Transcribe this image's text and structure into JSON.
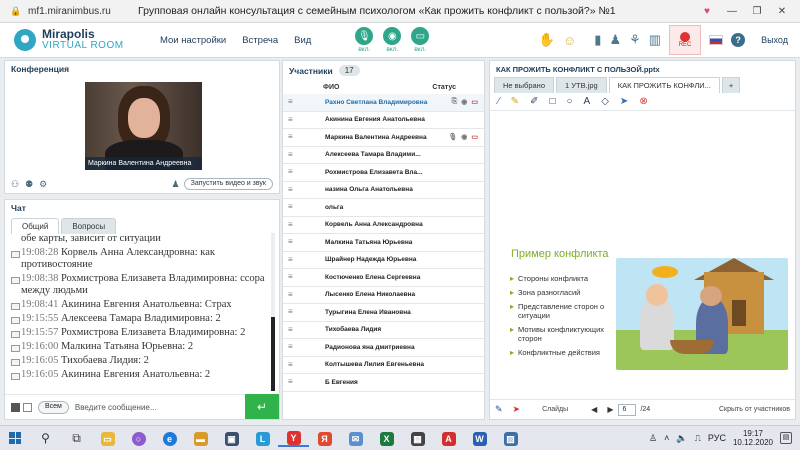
{
  "browser": {
    "domain": "mf1.miranimbus.ru",
    "title": "Групповая онлайн консультация с семейным психологом «Как прожить конфликт с пользой?» №1"
  },
  "header": {
    "logo_line1": "Mirapolis",
    "logo_line2": "VIRTUAL ROOM",
    "menu": [
      "Мои настройки",
      "Встреча",
      "Вид"
    ],
    "toggles": [
      {
        "icon": "microphone-icon",
        "label": "вкл."
      },
      {
        "icon": "camera-icon",
        "label": "вкл."
      },
      {
        "icon": "screen-share-icon",
        "label": "вкл."
      }
    ],
    "rec_label": "REC",
    "help_label": "?",
    "exit_label": "Выход"
  },
  "conference": {
    "title": "Конференция",
    "video_label": "Маркина Валентина  Андреевна",
    "start_video_label": "Запустить видео и звук"
  },
  "chat": {
    "title": "Чат",
    "tabs": [
      "Общий",
      "Вопросы"
    ],
    "messages": [
      {
        "time": "",
        "text": "обе карты, зависит от ситуации"
      },
      {
        "time": "19:08:28",
        "text": "Корвель Анна  Александровна: как противостояние"
      },
      {
        "time": "19:08:38",
        "text": "Рохмистрова  Елизавета Владимировна: ссора между людьми"
      },
      {
        "time": "19:08:41",
        "text": "Акинина  Евгения Анатольевна: Страх"
      },
      {
        "time": "19:15:55",
        "text": "Алексеева   Тамара  Владимировна: 2"
      },
      {
        "time": "19:15:57",
        "text": "Рохмистрова  Елизавета Владимировна: 2"
      },
      {
        "time": "19:16:00",
        "text": "Малкина Татьяна  Юрьевна: 2"
      },
      {
        "time": "19:16:05",
        "text": "Тихобаева Лидия: 2"
      },
      {
        "time": "19:16:05",
        "text": "Акинина  Евгения Анатольевна: 2"
      }
    ],
    "recipient": "Всем",
    "input_placeholder": "Введите сообщение..."
  },
  "participants": {
    "title": "Участники",
    "count": "17",
    "col_name": "ФИО",
    "col_status": "Статус",
    "rows": [
      "Рахно Светлана  Владимировна",
      "Акинина  Евгения Анатольевна",
      "Маркина Валентина  Андреевна",
      "Алексеева   Тамара  Владими...",
      "Рохмистрова  Елизавета Вла...",
      "назина  Ольга Анатольевна",
      "ольга",
      "Корвель Анна  Александровна",
      "Малкина Татьяна  Юрьевна",
      "Шрайнер Надежда  Юрьевна",
      "Костюченко  Елена Сергеевна",
      "Лысенко  Елена  Николаевна",
      "Турыгина  Елена  Ивановна",
      "Тихобаева Лидия",
      "Радионова яна  дмитриевна",
      "Колтышева  Лилия Евгеньевна",
      "Б  Евгения"
    ]
  },
  "presentation": {
    "title": "КАК ПРОЖИТЬ КОНФЛИКТ С ПОЛЬЗОЙ.pptx",
    "tabs": [
      "Не выбрано",
      "1 УТВ.jpg",
      "КАК ПРОЖИТЬ КОНФЛИ...",
      "+"
    ],
    "slide_title": "Пример конфликта",
    "bullets": [
      "Стороны конфликта",
      "Зона разногласий",
      "Представление сторон о ситуации",
      "Мотивы конфликтующих сторон",
      "Конфликтные действия"
    ],
    "slides_label": "Слайды",
    "current_page": "6",
    "total_pages": "/24",
    "hide_label": "Скрыть от участников"
  },
  "taskbar": {
    "lang": "РУС",
    "time": "19:17",
    "date": "10.12.2020"
  }
}
